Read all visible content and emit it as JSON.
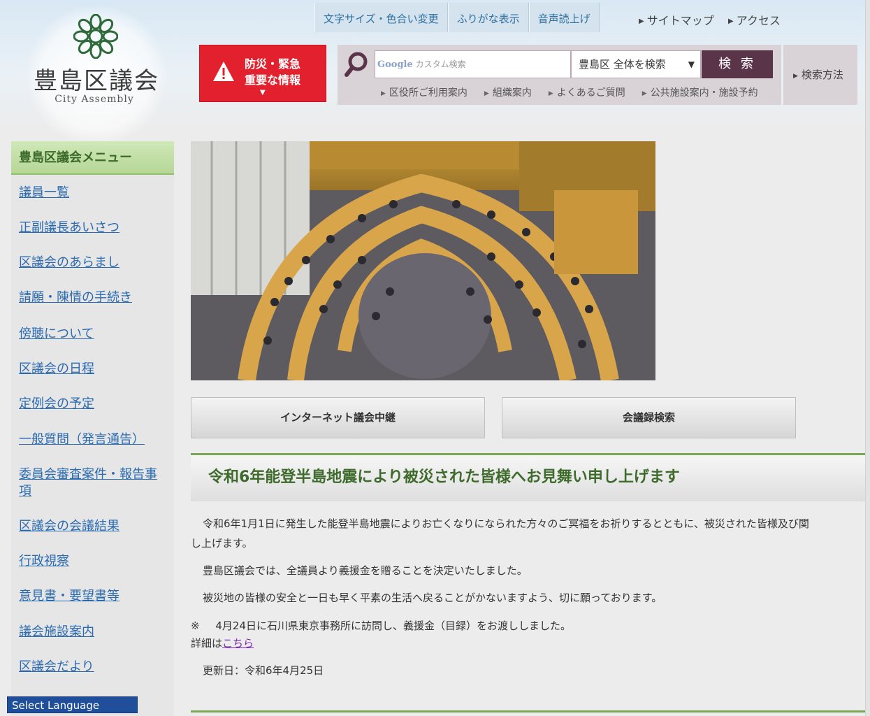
{
  "logo": {
    "title": "豊島区議会",
    "subtitle": "City Assembly"
  },
  "utility": {
    "text_size": "文字サイズ・色合い変更",
    "furigana": "ふりがな表示",
    "audio": "音声読上げ",
    "sitemap": "サイトマップ",
    "access": "アクセス"
  },
  "emergency": {
    "line1": "防災・緊急",
    "line2": "重要な情報"
  },
  "search": {
    "google": "Google",
    "placeholder": "カスタム検索",
    "scope": "豊島区 全体を検索",
    "button": "検 索",
    "help": "検索方法",
    "quick_links": [
      "区役所ご利用案内",
      "組織案内",
      "よくあるご質問",
      "公共施設案内・施設予約"
    ]
  },
  "sidebar": {
    "title": "豊島区議会メニュー",
    "items": [
      {
        "label": "議員一覧"
      },
      {
        "label": "正副議長あいさつ"
      },
      {
        "label": "区議会のあらまし"
      },
      {
        "label": "請願・陳情の手続き"
      },
      {
        "label": "傍聴について"
      },
      {
        "label": "区議会の日程"
      },
      {
        "label": "定例会の予定"
      },
      {
        "label": "一般質問（発言通告）"
      },
      {
        "label": "委員会審査案件・報告事項"
      },
      {
        "label": "区議会の会議結果"
      },
      {
        "label": "行政視察"
      },
      {
        "label": "意見書・要望書等"
      },
      {
        "label": "議会施設案内"
      },
      {
        "label": "区議会だより"
      }
    ]
  },
  "language": {
    "label": "Select Language"
  },
  "main": {
    "btn_live": "インターネット議会中継",
    "btn_minutes": "会議録検索",
    "notice_title": "令和6年能登半島地震により被災された皆様へお見舞い申し上げます",
    "para1a": "令和6年1月1日に発生した能登半島地震によりお亡くなりになられた方々のご冥福をお祈りするとともに、被災された皆様及び関",
    "para1b": "し上げます。",
    "para2": "豊島区議会では、全議員より義援金を贈ることを決定いたしました。",
    "para3": "被災地の皆様の安全と一日も早く平素の生活へ戻ることがかないますよう、切に願っております。",
    "note_mark": "※",
    "note": "4月24日に石川県東京事務所に訪問し、義援金（目録）をお渡ししました。",
    "detail_prefix": "詳細は",
    "detail_link": "こちら",
    "updated": "更新日：令和6年4月25日"
  },
  "colors": {
    "emergency": "#e3202d",
    "search_button": "#5a3448",
    "accent_green": "#7aa656",
    "link_blue": "#2a6ab0"
  }
}
